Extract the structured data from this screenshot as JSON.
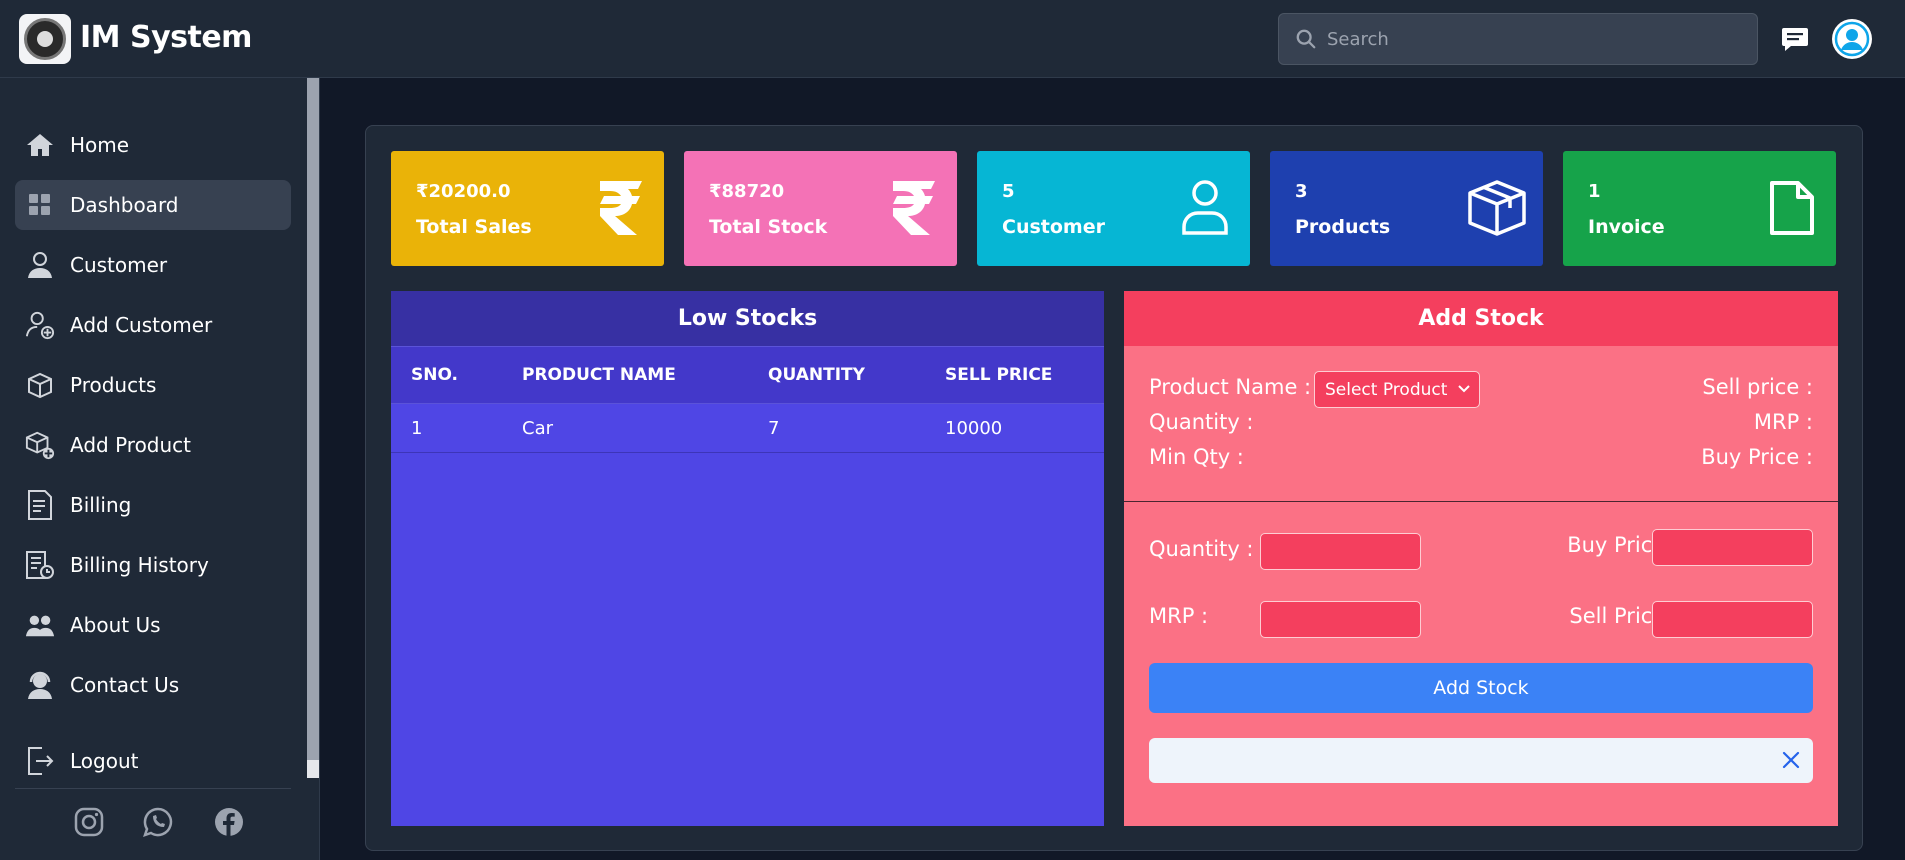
{
  "app": {
    "title": "IM System"
  },
  "header": {
    "search_placeholder": "Search"
  },
  "sidebar": {
    "items": [
      {
        "label": "Home",
        "icon": "home-icon",
        "active": false
      },
      {
        "label": "Dashboard",
        "icon": "dashboard-icon",
        "active": true
      },
      {
        "label": "Customer",
        "icon": "customer-icon",
        "active": false
      },
      {
        "label": "Add Customer",
        "icon": "add-customer-icon",
        "active": false
      },
      {
        "label": "Products",
        "icon": "box-icon",
        "active": false
      },
      {
        "label": "Add Product",
        "icon": "add-product-icon",
        "active": false
      },
      {
        "label": "Billing",
        "icon": "billing-icon",
        "active": false
      },
      {
        "label": "Billing History",
        "icon": "billing-history-icon",
        "active": false
      },
      {
        "label": "About Us",
        "icon": "about-icon",
        "active": false
      },
      {
        "label": "Contact Us",
        "icon": "contact-icon",
        "active": false
      }
    ],
    "logout": "Logout",
    "social": [
      "instagram-icon",
      "whatsapp-icon",
      "facebook-icon"
    ]
  },
  "stats": [
    {
      "value": "₹20200.0",
      "label": "Total Sales",
      "color": "#eab308",
      "icon": "rupee-icon"
    },
    {
      "value": "₹88720",
      "label": "Total Stock",
      "color": "#f472b6",
      "icon": "rupee-icon"
    },
    {
      "value": "5",
      "label": "Customer",
      "color": "#06b6d4",
      "icon": "user-icon"
    },
    {
      "value": "3",
      "label": "Products",
      "color": "#1e40af",
      "icon": "box-icon"
    },
    {
      "value": "1",
      "label": "Invoice",
      "color": "#16a34a",
      "icon": "file-icon"
    }
  ],
  "low_stocks": {
    "title": "Low Stocks",
    "columns": [
      "SNO.",
      "PRODUCT NAME",
      "QUANTITY",
      "SELL PRICE"
    ],
    "rows": [
      [
        "1",
        "Car",
        "7",
        "10000"
      ]
    ]
  },
  "add_stock": {
    "title": "Add Stock",
    "product_name_label": "Product Name :",
    "select_value": "Select Product",
    "quantity_label": "Quantity :",
    "min_qty_label": "Min Qty :",
    "sell_price_label": "Sell price :",
    "mrp_label": "MRP :",
    "buy_price_label": "Buy Price :",
    "form": {
      "quantity_label": "Quantity :",
      "buy_price_label": "Buy Price :",
      "mrp_label": "MRP :",
      "sell_price_label": "Sell Price :"
    },
    "button": "Add Stock"
  }
}
